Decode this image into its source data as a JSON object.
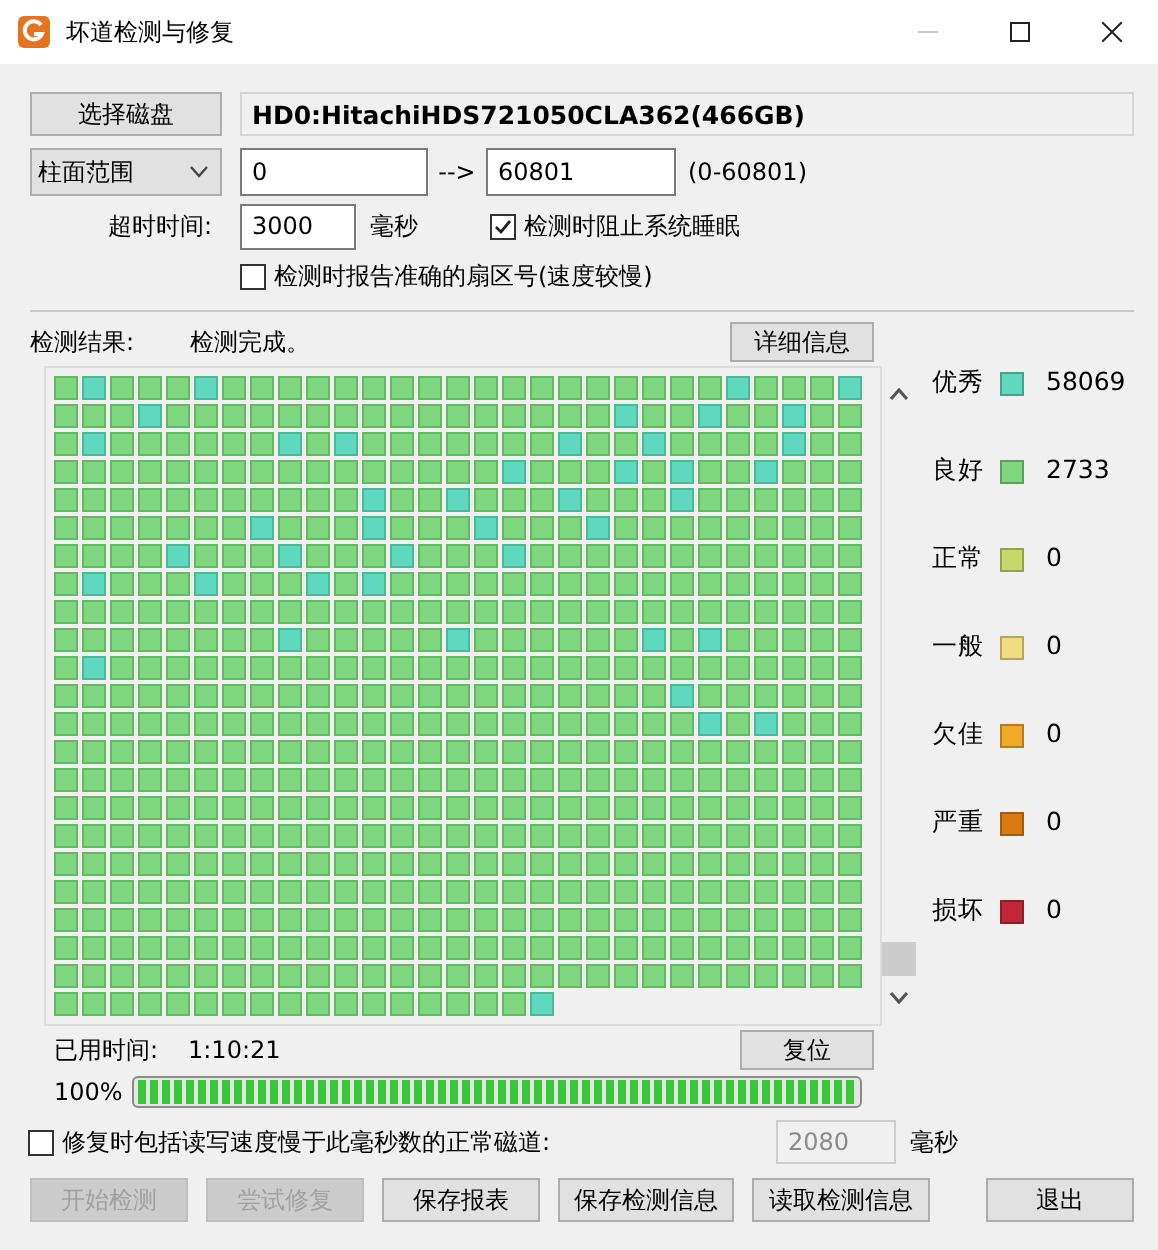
{
  "window": {
    "title": "坏道检测与修复",
    "controls": [
      {
        "kind": "minimize",
        "disabled": true
      },
      {
        "kind": "maximize",
        "disabled": false
      },
      {
        "kind": "close",
        "disabled": false
      }
    ]
  },
  "disk": {
    "button": "选择磁盘",
    "name": "HD0:HitachiHDS721050CLA362(466GB)"
  },
  "range": {
    "mode": "柱面范围",
    "from": "0",
    "arrow": "-->",
    "to": "60801",
    "limits": "(0-60801)"
  },
  "timeout": {
    "label": "超时时间:",
    "value": "3000",
    "unit": "毫秒"
  },
  "options": [
    {
      "label": "检测时阻止系统睡眠",
      "checked": true
    },
    {
      "label": "检测时报告准确的扇区号(速度较慢)",
      "checked": false
    }
  ],
  "result": {
    "label": "检测结果:",
    "status": "检测完成。",
    "details_button": "详细信息"
  },
  "blocks": {
    "rows": [
      [
        {
          "kind": "good"
        },
        {
          "kind": "best"
        },
        {
          "kind": "good"
        },
        {
          "kind": "good"
        },
        {
          "kind": "good"
        },
        {
          "kind": "best"
        },
        {
          "kind": "good"
        },
        {
          "kind": "good"
        },
        {
          "kind": "good"
        },
        {
          "kind": "good"
        },
        {
          "kind": "good"
        },
        {
          "kind": "good"
        },
        {
          "kind": "good"
        },
        {
          "kind": "good"
        },
        {
          "kind": "good"
        },
        {
          "kind": "good"
        },
        {
          "kind": "good"
        },
        {
          "kind": "good"
        },
        {
          "kind": "good"
        },
        {
          "kind": "good"
        },
        {
          "kind": "good"
        },
        {
          "kind": "good"
        },
        {
          "kind": "good"
        },
        {
          "kind": "good"
        },
        {
          "kind": "best"
        },
        {
          "kind": "good"
        },
        {
          "kind": "good"
        },
        {
          "kind": "good"
        },
        {
          "kind": "best"
        }
      ],
      [
        {
          "kind": "good"
        },
        {
          "kind": "good"
        },
        {
          "kind": "good"
        },
        {
          "kind": "best"
        },
        {
          "kind": "good"
        },
        {
          "kind": "good"
        },
        {
          "kind": "good"
        },
        {
          "kind": "good"
        },
        {
          "kind": "good"
        },
        {
          "kind": "good"
        },
        {
          "kind": "good"
        },
        {
          "kind": "good"
        },
        {
          "kind": "good"
        },
        {
          "kind": "good"
        },
        {
          "kind": "good"
        },
        {
          "kind": "good"
        },
        {
          "kind": "good"
        },
        {
          "kind": "good"
        },
        {
          "kind": "good"
        },
        {
          "kind": "good"
        },
        {
          "kind": "best"
        },
        {
          "kind": "good"
        },
        {
          "kind": "good"
        },
        {
          "kind": "best"
        },
        {
          "kind": "good"
        },
        {
          "kind": "good"
        },
        {
          "kind": "best"
        },
        {
          "kind": "good"
        },
        {
          "kind": "good"
        }
      ],
      [
        {
          "kind": "good"
        },
        {
          "kind": "best"
        },
        {
          "kind": "good"
        },
        {
          "kind": "good"
        },
        {
          "kind": "good"
        },
        {
          "kind": "good"
        },
        {
          "kind": "good"
        },
        {
          "kind": "good"
        },
        {
          "kind": "best"
        },
        {
          "kind": "good"
        },
        {
          "kind": "best"
        },
        {
          "kind": "good"
        },
        {
          "kind": "good"
        },
        {
          "kind": "good"
        },
        {
          "kind": "good"
        },
        {
          "kind": "good"
        },
        {
          "kind": "good"
        },
        {
          "kind": "good"
        },
        {
          "kind": "best"
        },
        {
          "kind": "good"
        },
        {
          "kind": "good"
        },
        {
          "kind": "best"
        },
        {
          "kind": "good"
        },
        {
          "kind": "good"
        },
        {
          "kind": "good"
        },
        {
          "kind": "good"
        },
        {
          "kind": "best"
        },
        {
          "kind": "good"
        },
        {
          "kind": "good"
        }
      ],
      [
        {
          "kind": "good"
        },
        {
          "kind": "good"
        },
        {
          "kind": "good"
        },
        {
          "kind": "good"
        },
        {
          "kind": "good"
        },
        {
          "kind": "good"
        },
        {
          "kind": "good"
        },
        {
          "kind": "good"
        },
        {
          "kind": "good"
        },
        {
          "kind": "good"
        },
        {
          "kind": "good"
        },
        {
          "kind": "good"
        },
        {
          "kind": "good"
        },
        {
          "kind": "good"
        },
        {
          "kind": "good"
        },
        {
          "kind": "good"
        },
        {
          "kind": "best"
        },
        {
          "kind": "good"
        },
        {
          "kind": "good"
        },
        {
          "kind": "good"
        },
        {
          "kind": "best"
        },
        {
          "kind": "good"
        },
        {
          "kind": "best"
        },
        {
          "kind": "good"
        },
        {
          "kind": "good"
        },
        {
          "kind": "best"
        },
        {
          "kind": "good"
        },
        {
          "kind": "good"
        },
        {
          "kind": "good"
        }
      ],
      [
        {
          "kind": "good"
        },
        {
          "kind": "good"
        },
        {
          "kind": "good"
        },
        {
          "kind": "good"
        },
        {
          "kind": "good"
        },
        {
          "kind": "good"
        },
        {
          "kind": "good"
        },
        {
          "kind": "good"
        },
        {
          "kind": "good"
        },
        {
          "kind": "good"
        },
        {
          "kind": "good"
        },
        {
          "kind": "best"
        },
        {
          "kind": "good"
        },
        {
          "kind": "good"
        },
        {
          "kind": "best"
        },
        {
          "kind": "good"
        },
        {
          "kind": "good"
        },
        {
          "kind": "good"
        },
        {
          "kind": "best"
        },
        {
          "kind": "good"
        },
        {
          "kind": "good"
        },
        {
          "kind": "good"
        },
        {
          "kind": "best"
        },
        {
          "kind": "good"
        },
        {
          "kind": "good"
        },
        {
          "kind": "good"
        },
        {
          "kind": "good"
        },
        {
          "kind": "good"
        },
        {
          "kind": "good"
        }
      ],
      [
        {
          "kind": "good"
        },
        {
          "kind": "good"
        },
        {
          "kind": "good"
        },
        {
          "kind": "good"
        },
        {
          "kind": "good"
        },
        {
          "kind": "good"
        },
        {
          "kind": "good"
        },
        {
          "kind": "best"
        },
        {
          "kind": "good"
        },
        {
          "kind": "good"
        },
        {
          "kind": "good"
        },
        {
          "kind": "best"
        },
        {
          "kind": "good"
        },
        {
          "kind": "good"
        },
        {
          "kind": "good"
        },
        {
          "kind": "best"
        },
        {
          "kind": "good"
        },
        {
          "kind": "good"
        },
        {
          "kind": "good"
        },
        {
          "kind": "best"
        },
        {
          "kind": "good"
        },
        {
          "kind": "good"
        },
        {
          "kind": "good"
        },
        {
          "kind": "good"
        },
        {
          "kind": "good"
        },
        {
          "kind": "good"
        },
        {
          "kind": "good"
        },
        {
          "kind": "good"
        },
        {
          "kind": "good"
        }
      ],
      [
        {
          "kind": "good"
        },
        {
          "kind": "good"
        },
        {
          "kind": "good"
        },
        {
          "kind": "good"
        },
        {
          "kind": "best"
        },
        {
          "kind": "good"
        },
        {
          "kind": "good"
        },
        {
          "kind": "good"
        },
        {
          "kind": "best"
        },
        {
          "kind": "good"
        },
        {
          "kind": "good"
        },
        {
          "kind": "good"
        },
        {
          "kind": "best"
        },
        {
          "kind": "good"
        },
        {
          "kind": "good"
        },
        {
          "kind": "good"
        },
        {
          "kind": "best"
        },
        {
          "kind": "good"
        },
        {
          "kind": "good"
        },
        {
          "kind": "good"
        },
        {
          "kind": "good"
        },
        {
          "kind": "good"
        },
        {
          "kind": "good"
        },
        {
          "kind": "good"
        },
        {
          "kind": "good"
        },
        {
          "kind": "good"
        },
        {
          "kind": "good"
        },
        {
          "kind": "good"
        },
        {
          "kind": "good"
        }
      ],
      [
        {
          "kind": "good"
        },
        {
          "kind": "best"
        },
        {
          "kind": "good"
        },
        {
          "kind": "good"
        },
        {
          "kind": "good"
        },
        {
          "kind": "best"
        },
        {
          "kind": "good"
        },
        {
          "kind": "good"
        },
        {
          "kind": "good"
        },
        {
          "kind": "best"
        },
        {
          "kind": "good"
        },
        {
          "kind": "best"
        },
        {
          "kind": "good"
        },
        {
          "kind": "good"
        },
        {
          "kind": "good"
        },
        {
          "kind": "good"
        },
        {
          "kind": "good"
        },
        {
          "kind": "good"
        },
        {
          "kind": "good"
        },
        {
          "kind": "good"
        },
        {
          "kind": "good"
        },
        {
          "kind": "good"
        },
        {
          "kind": "good"
        },
        {
          "kind": "good"
        },
        {
          "kind": "good"
        },
        {
          "kind": "good"
        },
        {
          "kind": "good"
        },
        {
          "kind": "good"
        },
        {
          "kind": "good"
        }
      ],
      [
        {
          "kind": "good"
        },
        {
          "kind": "good"
        },
        {
          "kind": "good"
        },
        {
          "kind": "good"
        },
        {
          "kind": "good"
        },
        {
          "kind": "good"
        },
        {
          "kind": "good"
        },
        {
          "kind": "good"
        },
        {
          "kind": "good"
        },
        {
          "kind": "good"
        },
        {
          "kind": "good"
        },
        {
          "kind": "good"
        },
        {
          "kind": "good"
        },
        {
          "kind": "good"
        },
        {
          "kind": "good"
        },
        {
          "kind": "good"
        },
        {
          "kind": "good"
        },
        {
          "kind": "good"
        },
        {
          "kind": "good"
        },
        {
          "kind": "good"
        },
        {
          "kind": "good"
        },
        {
          "kind": "good"
        },
        {
          "kind": "good"
        },
        {
          "kind": "good"
        },
        {
          "kind": "good"
        },
        {
          "kind": "good"
        },
        {
          "kind": "good"
        },
        {
          "kind": "good"
        },
        {
          "kind": "good"
        }
      ],
      [
        {
          "kind": "good"
        },
        {
          "kind": "good"
        },
        {
          "kind": "good"
        },
        {
          "kind": "good"
        },
        {
          "kind": "good"
        },
        {
          "kind": "good"
        },
        {
          "kind": "good"
        },
        {
          "kind": "good"
        },
        {
          "kind": "best"
        },
        {
          "kind": "good"
        },
        {
          "kind": "good"
        },
        {
          "kind": "good"
        },
        {
          "kind": "good"
        },
        {
          "kind": "good"
        },
        {
          "kind": "best"
        },
        {
          "kind": "good"
        },
        {
          "kind": "good"
        },
        {
          "kind": "good"
        },
        {
          "kind": "good"
        },
        {
          "kind": "good"
        },
        {
          "kind": "good"
        },
        {
          "kind": "best"
        },
        {
          "kind": "good"
        },
        {
          "kind": "best"
        },
        {
          "kind": "good"
        },
        {
          "kind": "good"
        },
        {
          "kind": "good"
        },
        {
          "kind": "good"
        },
        {
          "kind": "good"
        }
      ],
      [
        {
          "kind": "good"
        },
        {
          "kind": "best"
        },
        {
          "kind": "good"
        },
        {
          "kind": "good"
        },
        {
          "kind": "good"
        },
        {
          "kind": "good"
        },
        {
          "kind": "good"
        },
        {
          "kind": "good"
        },
        {
          "kind": "good"
        },
        {
          "kind": "good"
        },
        {
          "kind": "good"
        },
        {
          "kind": "good"
        },
        {
          "kind": "good"
        },
        {
          "kind": "good"
        },
        {
          "kind": "good"
        },
        {
          "kind": "good"
        },
        {
          "kind": "good"
        },
        {
          "kind": "good"
        },
        {
          "kind": "good"
        },
        {
          "kind": "good"
        },
        {
          "kind": "good"
        },
        {
          "kind": "good"
        },
        {
          "kind": "good"
        },
        {
          "kind": "good"
        },
        {
          "kind": "good"
        },
        {
          "kind": "good"
        },
        {
          "kind": "good"
        },
        {
          "kind": "good"
        },
        {
          "kind": "good"
        }
      ],
      [
        {
          "kind": "good"
        },
        {
          "kind": "good"
        },
        {
          "kind": "good"
        },
        {
          "kind": "good"
        },
        {
          "kind": "good"
        },
        {
          "kind": "good"
        },
        {
          "kind": "good"
        },
        {
          "kind": "good"
        },
        {
          "kind": "good"
        },
        {
          "kind": "good"
        },
        {
          "kind": "good"
        },
        {
          "kind": "good"
        },
        {
          "kind": "good"
        },
        {
          "kind": "good"
        },
        {
          "kind": "good"
        },
        {
          "kind": "good"
        },
        {
          "kind": "good"
        },
        {
          "kind": "good"
        },
        {
          "kind": "good"
        },
        {
          "kind": "good"
        },
        {
          "kind": "good"
        },
        {
          "kind": "good"
        },
        {
          "kind": "best"
        },
        {
          "kind": "good"
        },
        {
          "kind": "good"
        },
        {
          "kind": "good"
        },
        {
          "kind": "good"
        },
        {
          "kind": "good"
        },
        {
          "kind": "good"
        }
      ],
      [
        {
          "kind": "good"
        },
        {
          "kind": "good"
        },
        {
          "kind": "good"
        },
        {
          "kind": "good"
        },
        {
          "kind": "good"
        },
        {
          "kind": "good"
        },
        {
          "kind": "good"
        },
        {
          "kind": "good"
        },
        {
          "kind": "good"
        },
        {
          "kind": "good"
        },
        {
          "kind": "good"
        },
        {
          "kind": "good"
        },
        {
          "kind": "good"
        },
        {
          "kind": "good"
        },
        {
          "kind": "good"
        },
        {
          "kind": "good"
        },
        {
          "kind": "good"
        },
        {
          "kind": "good"
        },
        {
          "kind": "good"
        },
        {
          "kind": "good"
        },
        {
          "kind": "good"
        },
        {
          "kind": "good"
        },
        {
          "kind": "good"
        },
        {
          "kind": "best"
        },
        {
          "kind": "good"
        },
        {
          "kind": "best"
        },
        {
          "kind": "good"
        },
        {
          "kind": "good"
        },
        {
          "kind": "good"
        }
      ],
      [
        {
          "kind": "good"
        },
        {
          "kind": "good"
        },
        {
          "kind": "good"
        },
        {
          "kind": "good"
        },
        {
          "kind": "good"
        },
        {
          "kind": "good"
        },
        {
          "kind": "good"
        },
        {
          "kind": "good"
        },
        {
          "kind": "good"
        },
        {
          "kind": "good"
        },
        {
          "kind": "good"
        },
        {
          "kind": "good"
        },
        {
          "kind": "good"
        },
        {
          "kind": "good"
        },
        {
          "kind": "good"
        },
        {
          "kind": "good"
        },
        {
          "kind": "good"
        },
        {
          "kind": "good"
        },
        {
          "kind": "good"
        },
        {
          "kind": "good"
        },
        {
          "kind": "good"
        },
        {
          "kind": "good"
        },
        {
          "kind": "good"
        },
        {
          "kind": "good"
        },
        {
          "kind": "good"
        },
        {
          "kind": "good"
        },
        {
          "kind": "good"
        },
        {
          "kind": "good"
        },
        {
          "kind": "good"
        }
      ],
      [
        {
          "kind": "good"
        },
        {
          "kind": "good"
        },
        {
          "kind": "good"
        },
        {
          "kind": "good"
        },
        {
          "kind": "good"
        },
        {
          "kind": "good"
        },
        {
          "kind": "good"
        },
        {
          "kind": "good"
        },
        {
          "kind": "good"
        },
        {
          "kind": "good"
        },
        {
          "kind": "good"
        },
        {
          "kind": "good"
        },
        {
          "kind": "good"
        },
        {
          "kind": "good"
        },
        {
          "kind": "good"
        },
        {
          "kind": "good"
        },
        {
          "kind": "good"
        },
        {
          "kind": "good"
        },
        {
          "kind": "good"
        },
        {
          "kind": "good"
        },
        {
          "kind": "good"
        },
        {
          "kind": "good"
        },
        {
          "kind": "good"
        },
        {
          "kind": "good"
        },
        {
          "kind": "good"
        },
        {
          "kind": "good"
        },
        {
          "kind": "good"
        },
        {
          "kind": "good"
        },
        {
          "kind": "good"
        }
      ],
      [
        {
          "kind": "good"
        },
        {
          "kind": "good"
        },
        {
          "kind": "good"
        },
        {
          "kind": "good"
        },
        {
          "kind": "good"
        },
        {
          "kind": "good"
        },
        {
          "kind": "good"
        },
        {
          "kind": "good"
        },
        {
          "kind": "good"
        },
        {
          "kind": "good"
        },
        {
          "kind": "good"
        },
        {
          "kind": "good"
        },
        {
          "kind": "good"
        },
        {
          "kind": "good"
        },
        {
          "kind": "good"
        },
        {
          "kind": "good"
        },
        {
          "kind": "good"
        },
        {
          "kind": "good"
        },
        {
          "kind": "good"
        },
        {
          "kind": "good"
        },
        {
          "kind": "good"
        },
        {
          "kind": "good"
        },
        {
          "kind": "good"
        },
        {
          "kind": "good"
        },
        {
          "kind": "good"
        },
        {
          "kind": "good"
        },
        {
          "kind": "good"
        },
        {
          "kind": "good"
        },
        {
          "kind": "good"
        }
      ],
      [
        {
          "kind": "good"
        },
        {
          "kind": "good"
        },
        {
          "kind": "good"
        },
        {
          "kind": "good"
        },
        {
          "kind": "good"
        },
        {
          "kind": "good"
        },
        {
          "kind": "good"
        },
        {
          "kind": "good"
        },
        {
          "kind": "good"
        },
        {
          "kind": "good"
        },
        {
          "kind": "good"
        },
        {
          "kind": "good"
        },
        {
          "kind": "good"
        },
        {
          "kind": "good"
        },
        {
          "kind": "good"
        },
        {
          "kind": "good"
        },
        {
          "kind": "good"
        },
        {
          "kind": "good"
        },
        {
          "kind": "good"
        },
        {
          "kind": "good"
        },
        {
          "kind": "good"
        },
        {
          "kind": "good"
        },
        {
          "kind": "good"
        },
        {
          "kind": "good"
        },
        {
          "kind": "good"
        },
        {
          "kind": "good"
        },
        {
          "kind": "good"
        },
        {
          "kind": "good"
        },
        {
          "kind": "good"
        }
      ],
      [
        {
          "kind": "good"
        },
        {
          "kind": "good"
        },
        {
          "kind": "good"
        },
        {
          "kind": "good"
        },
        {
          "kind": "good"
        },
        {
          "kind": "good"
        },
        {
          "kind": "good"
        },
        {
          "kind": "good"
        },
        {
          "kind": "good"
        },
        {
          "kind": "good"
        },
        {
          "kind": "good"
        },
        {
          "kind": "good"
        },
        {
          "kind": "good"
        },
        {
          "kind": "good"
        },
        {
          "kind": "good"
        },
        {
          "kind": "good"
        },
        {
          "kind": "good"
        },
        {
          "kind": "good"
        },
        {
          "kind": "good"
        },
        {
          "kind": "good"
        },
        {
          "kind": "good"
        },
        {
          "kind": "good"
        },
        {
          "kind": "good"
        },
        {
          "kind": "good"
        },
        {
          "kind": "good"
        },
        {
          "kind": "good"
        },
        {
          "kind": "good"
        },
        {
          "kind": "good"
        },
        {
          "kind": "good"
        }
      ],
      [
        {
          "kind": "good"
        },
        {
          "kind": "good"
        },
        {
          "kind": "good"
        },
        {
          "kind": "good"
        },
        {
          "kind": "good"
        },
        {
          "kind": "good"
        },
        {
          "kind": "good"
        },
        {
          "kind": "good"
        },
        {
          "kind": "good"
        },
        {
          "kind": "good"
        },
        {
          "kind": "good"
        },
        {
          "kind": "good"
        },
        {
          "kind": "good"
        },
        {
          "kind": "good"
        },
        {
          "kind": "good"
        },
        {
          "kind": "good"
        },
        {
          "kind": "good"
        },
        {
          "kind": "good"
        },
        {
          "kind": "good"
        },
        {
          "kind": "good"
        },
        {
          "kind": "good"
        },
        {
          "kind": "good"
        },
        {
          "kind": "good"
        },
        {
          "kind": "good"
        },
        {
          "kind": "good"
        },
        {
          "kind": "good"
        },
        {
          "kind": "good"
        },
        {
          "kind": "good"
        },
        {
          "kind": "good"
        }
      ],
      [
        {
          "kind": "good"
        },
        {
          "kind": "good"
        },
        {
          "kind": "good"
        },
        {
          "kind": "good"
        },
        {
          "kind": "good"
        },
        {
          "kind": "good"
        },
        {
          "kind": "good"
        },
        {
          "kind": "good"
        },
        {
          "kind": "good"
        },
        {
          "kind": "good"
        },
        {
          "kind": "good"
        },
        {
          "kind": "good"
        },
        {
          "kind": "good"
        },
        {
          "kind": "good"
        },
        {
          "kind": "good"
        },
        {
          "kind": "good"
        },
        {
          "kind": "good"
        },
        {
          "kind": "good"
        },
        {
          "kind": "good"
        },
        {
          "kind": "good"
        },
        {
          "kind": "good"
        },
        {
          "kind": "good"
        },
        {
          "kind": "good"
        },
        {
          "kind": "good"
        },
        {
          "kind": "good"
        },
        {
          "kind": "good"
        },
        {
          "kind": "good"
        },
        {
          "kind": "good"
        },
        {
          "kind": "good"
        }
      ],
      [
        {
          "kind": "good"
        },
        {
          "kind": "good"
        },
        {
          "kind": "good"
        },
        {
          "kind": "good"
        },
        {
          "kind": "good"
        },
        {
          "kind": "good"
        },
        {
          "kind": "good"
        },
        {
          "kind": "good"
        },
        {
          "kind": "good"
        },
        {
          "kind": "good"
        },
        {
          "kind": "good"
        },
        {
          "kind": "good"
        },
        {
          "kind": "good"
        },
        {
          "kind": "good"
        },
        {
          "kind": "good"
        },
        {
          "kind": "good"
        },
        {
          "kind": "good"
        },
        {
          "kind": "good"
        },
        {
          "kind": "good"
        },
        {
          "kind": "good"
        },
        {
          "kind": "good"
        },
        {
          "kind": "good"
        },
        {
          "kind": "good"
        },
        {
          "kind": "good"
        },
        {
          "kind": "good"
        },
        {
          "kind": "good"
        },
        {
          "kind": "good"
        },
        {
          "kind": "good"
        },
        {
          "kind": "good"
        }
      ],
      [
        {
          "kind": "good"
        },
        {
          "kind": "good"
        },
        {
          "kind": "good"
        },
        {
          "kind": "good"
        },
        {
          "kind": "good"
        },
        {
          "kind": "good"
        },
        {
          "kind": "good"
        },
        {
          "kind": "good"
        },
        {
          "kind": "good"
        },
        {
          "kind": "good"
        },
        {
          "kind": "good"
        },
        {
          "kind": "good"
        },
        {
          "kind": "good"
        },
        {
          "kind": "good"
        },
        {
          "kind": "good"
        },
        {
          "kind": "good"
        },
        {
          "kind": "good"
        },
        {
          "kind": "good"
        },
        {
          "kind": "good"
        },
        {
          "kind": "good"
        },
        {
          "kind": "good"
        },
        {
          "kind": "good"
        },
        {
          "kind": "good"
        },
        {
          "kind": "good"
        },
        {
          "kind": "good"
        },
        {
          "kind": "good"
        },
        {
          "kind": "good"
        },
        {
          "kind": "good"
        },
        {
          "kind": "good"
        }
      ],
      [
        {
          "kind": "good"
        },
        {
          "kind": "good"
        },
        {
          "kind": "good"
        },
        {
          "kind": "good"
        },
        {
          "kind": "good"
        },
        {
          "kind": "good"
        },
        {
          "kind": "good"
        },
        {
          "kind": "good"
        },
        {
          "kind": "good"
        },
        {
          "kind": "good"
        },
        {
          "kind": "good"
        },
        {
          "kind": "good"
        },
        {
          "kind": "good"
        },
        {
          "kind": "good"
        },
        {
          "kind": "good"
        },
        {
          "kind": "good"
        },
        {
          "kind": "good"
        },
        {
          "kind": "best"
        }
      ]
    ]
  },
  "legend": [
    {
      "label": "优秀",
      "color": "#5fd8c0",
      "count": "58069"
    },
    {
      "label": "良好",
      "color": "#7ed67e",
      "count": "2733"
    },
    {
      "label": "正常",
      "color": "#c6d86a",
      "count": "0"
    },
    {
      "label": "一般",
      "color": "#f2dc82",
      "count": "0"
    },
    {
      "label": "欠佳",
      "color": "#f0aa28",
      "count": "0"
    },
    {
      "label": "严重",
      "color": "#d87a10",
      "count": "0"
    },
    {
      "label": "损坏",
      "color": "#c02838",
      "count": "0"
    }
  ],
  "elapsed": {
    "label": "已用时间:",
    "value": "1:10:21",
    "reset_button": "复位"
  },
  "progress": {
    "text": "100%",
    "level": 1
  },
  "repair_option": {
    "label": "修复时包括读写速度慢于此毫秒数的正常磁道:",
    "checked": false,
    "value": "2080",
    "disabled": true,
    "unit": "毫秒"
  },
  "buttons": [
    {
      "label": "开始检测",
      "disabled": true
    },
    {
      "label": "尝试修复",
      "disabled": true
    },
    {
      "label": "保存报表",
      "disabled": false
    },
    {
      "label": "保存检测信息",
      "disabled": false
    },
    {
      "label": "读取检测信息",
      "disabled": false
    },
    {
      "label": "退出",
      "disabled": false,
      "kind": "exit"
    }
  ]
}
